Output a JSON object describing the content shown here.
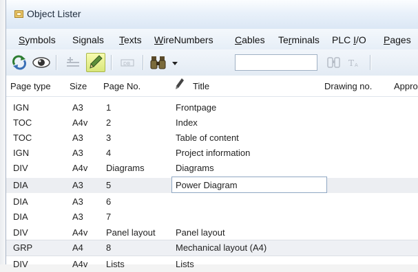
{
  "window": {
    "title": "Object Lister"
  },
  "menu": [
    {
      "label": "Symbols",
      "ul": "S",
      "rest": "ymbols"
    },
    {
      "label": "Signals",
      "ul": "",
      "rest": "Signals"
    },
    {
      "label": "Texts",
      "ul": "T",
      "rest": "exts"
    },
    {
      "label": "WireNumbers",
      "ul": "W",
      "rest": "ireNumbers"
    },
    {
      "label": "Cables",
      "ul": "C",
      "rest": "ables"
    },
    {
      "label": "Terminals",
      "ul": "",
      "rest": "Terminals"
    },
    {
      "label": "PLC I/O",
      "ul": "",
      "rest": "PLC I/O"
    },
    {
      "label": "Pages",
      "ul": "P",
      "rest": "ages"
    }
  ],
  "toolbar": {
    "icons": [
      "refresh-icon",
      "eye-icon",
      "insert-icon",
      "pencil-icon",
      "db-icon",
      "binoculars-icon",
      "dropdown-arrow-icon",
      "replace-icon",
      "text-size-icon"
    ],
    "search_value": ""
  },
  "columns": [
    "Page type",
    "Size",
    "Page No.",
    "Title",
    "Drawing no.",
    "Appro"
  ],
  "rows": [
    {
      "type": "IGN",
      "size": "A3",
      "no": "1",
      "title": "Frontpage"
    },
    {
      "type": "TOC",
      "size": "A4v",
      "no": "2",
      "title": "Index"
    },
    {
      "type": "TOC",
      "size": "A3",
      "no": "3",
      "title": "Table of content"
    },
    {
      "type": "IGN",
      "size": "A3",
      "no": "4",
      "title": "Project information"
    },
    {
      "type": "DIV",
      "size": "A4v",
      "no": "Diagrams",
      "title": "Diagrams"
    },
    {
      "type": "DIA",
      "size": "A3",
      "no": "5",
      "title": "Power Diagram"
    },
    {
      "type": "DIA",
      "size": "A3",
      "no": "6",
      "title": ""
    },
    {
      "type": "DIA",
      "size": "A3",
      "no": "7",
      "title": ""
    },
    {
      "type": "DIV",
      "size": "A4v",
      "no": "Panel layout",
      "title": "Panel layout"
    },
    {
      "type": "GRP",
      "size": "A4",
      "no": "8",
      "title": "Mechanical layout (A4)"
    },
    {
      "type": "DIV",
      "size": "A4v",
      "no": "Lists",
      "title": "Lists"
    }
  ],
  "colors": {
    "selected_row": "#eceef2",
    "active_tool": "#e3ee8a"
  }
}
